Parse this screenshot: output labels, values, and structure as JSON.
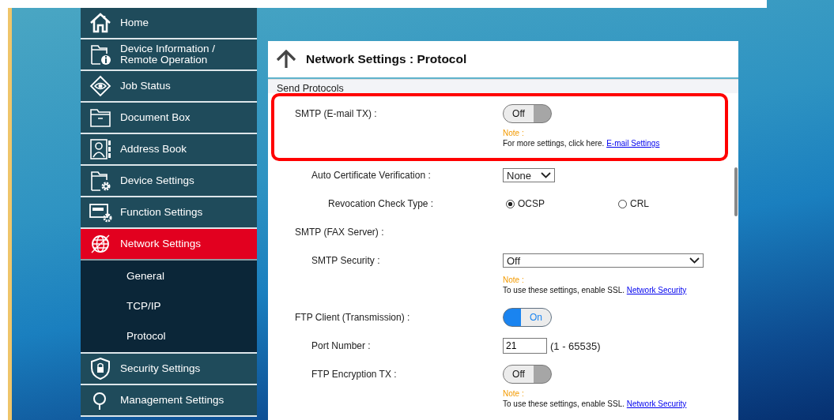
{
  "sidebar": {
    "items": [
      {
        "label": "Home",
        "selected": false
      },
      {
        "label": "Device Information /\nRemote Operation",
        "selected": false
      },
      {
        "label": "Job Status",
        "selected": false
      },
      {
        "label": "Document Box",
        "selected": false
      },
      {
        "label": "Address Book",
        "selected": false
      },
      {
        "label": "Device Settings",
        "selected": false
      },
      {
        "label": "Function Settings",
        "selected": false
      },
      {
        "label": "Network Settings",
        "selected": true,
        "children": [
          {
            "label": "General",
            "selected": false
          },
          {
            "label": "TCP/IP",
            "selected": false
          },
          {
            "label": "Protocol",
            "selected": false
          }
        ]
      },
      {
        "label": "Security Settings",
        "selected": false
      },
      {
        "label": "Management Settings",
        "selected": false
      }
    ]
  },
  "page": {
    "title": "Network Settings : Protocol"
  },
  "section": {
    "title": "Send Protocols",
    "rows": [
      {
        "kind": "toggle",
        "label": "SMTP (E-mail TX) :",
        "on": false,
        "text": "Off",
        "highlighted": true,
        "note": {
          "label": "Note :",
          "text": "For more settings, click here.",
          "link": "E-mail Settings"
        },
        "children": [
          {
            "kind": "select",
            "label": "Auto Certificate Verification :",
            "value": "None",
            "highlighted": false,
            "children": [
              {
                "kind": "radio",
                "label": "Revocation Check Type :",
                "highlighted": false,
                "options": [
                  {
                    "label": "OCSP",
                    "selected": true
                  },
                  {
                    "label": "CRL",
                    "selected": false
                  }
                ]
              }
            ]
          }
        ]
      },
      {
        "kind": "heading",
        "label": "SMTP (FAX Server) :",
        "highlighted": false,
        "children": [
          {
            "kind": "select-wide",
            "label": "SMTP Security :",
            "value": "Off",
            "highlighted": false,
            "note": {
              "label": "Note :",
              "text": "To use these settings, enable SSL.",
              "link": "Network Security"
            }
          }
        ]
      },
      {
        "kind": "toggle",
        "label": "FTP Client (Transmission) :",
        "on": true,
        "text": "On",
        "highlighted": false,
        "children": [
          {
            "kind": "number",
            "label": "Port Number :",
            "value": "21",
            "range": "(1 - 65535)",
            "highlighted": false
          },
          {
            "kind": "toggle",
            "label": "FTP Encryption TX :",
            "on": false,
            "text": "Off",
            "highlighted": false,
            "note": {
              "label": "Note :",
              "text": "To use these settings, enable SSL.",
              "link": "Network Security"
            }
          }
        ]
      }
    ]
  }
}
